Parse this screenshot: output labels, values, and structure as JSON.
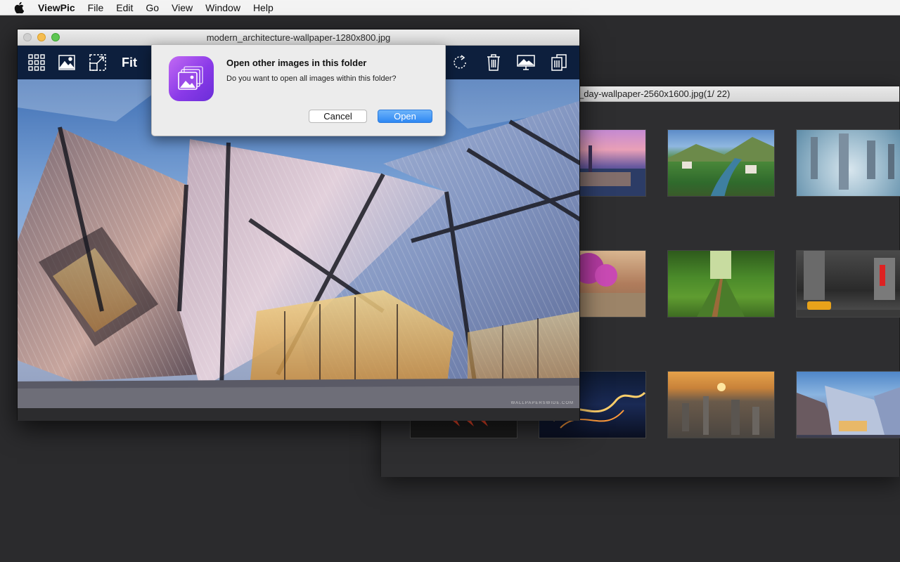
{
  "menubar": {
    "app_name": "ViewPic",
    "items": [
      "File",
      "Edit",
      "Go",
      "View",
      "Window",
      "Help"
    ]
  },
  "background_window": {
    "title": "ach_day-wallpaper-2560x1600.jpg(1/ 22)",
    "thumbnails": [
      "city-at-dusk",
      "river-valley-town",
      "skyscrapers-above-clouds",
      "flower-street",
      "forest-railway",
      "city-street-taxi",
      "car-lights",
      "winding-road-night",
      "city-sunset",
      "architecture"
    ]
  },
  "main_window": {
    "title": "modern_architecture-wallpaper-1280x800.jpg",
    "toolbar": {
      "fit_label": "Fit",
      "icons": [
        "grid-icon",
        "image-icon",
        "resize-icon",
        "rotate-icon",
        "trash-icon",
        "wallpaper-icon",
        "share-icon"
      ]
    },
    "watermark": "WALLPAPERSWIDE.COM"
  },
  "dialog": {
    "title": "Open other images in this folder",
    "message": "Do you want to open all images within this folder?",
    "cancel_label": "Cancel",
    "open_label": "Open",
    "accent": "#2f88f3",
    "icon": "stacked-images-icon"
  }
}
